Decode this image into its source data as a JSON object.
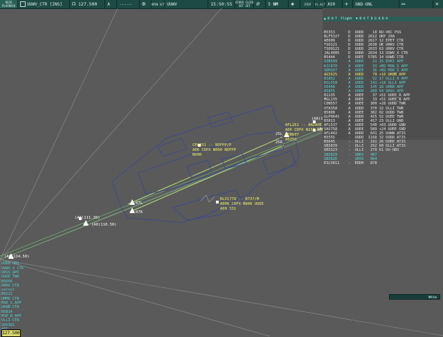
{
  "topbar": {
    "app_label_1": "RECD",
    "app_label_2": "PLAYBACK",
    "sector": "UUWV_CTR [INS]",
    "frequency": "127.500",
    "frequency_sub": "A",
    "blank_field": "-----",
    "open_sct_label": "OPEN SCT",
    "open_sct_value": "UUWV",
    "time": "15:50:55",
    "other_clock_label": "OTHER CLOCK",
    "set_1": "SET",
    "set_2": "SET",
    "range_value": "5",
    "range_unit": "NM",
    "step_label": "STEP",
    "fl_label": "FL ALT",
    "fl_value": "A50",
    "filter_value": "GND-UNL",
    "icons": [
      "headset-icon",
      "settings-icon",
      "cursor-icon",
      "satellite-icon",
      "nav-icon",
      "window-icon",
      "layout-icon",
      "close-icon"
    ]
  },
  "flight_list": {
    "header": "▲ D O T  Flight  ▼ D A T D G O D O",
    "rows": [
      {
        "text": "B5353      D  UUDD    18 RU-VKC PSS",
        "color": "white"
      },
      {
        "text": "BLF5327    D  UUDD  2612 UKP 20A",
        "color": "white"
      },
      {
        "text": "AE609      D  UUDD  2617 12 EPET CTR",
        "color": "white"
      },
      {
        "text": "TSO121     D  UUDD  2630 UK URRV CTR",
        "color": "white"
      },
      {
        "text": "TSO9121    D  UUDD  2633 63 URRV CTR",
        "color": "white"
      },
      {
        "text": "JAL4005    D  UUDD  2634 13 UUWV_X CTR",
        "color": "white"
      },
      {
        "text": "B5444      D  UUEE  5785 14 UUWD CTR",
        "color": "white"
      },
      {
        "text": "UZB509     A  UUDD    21 15 EVKI APP",
        "color": "blue"
      },
      {
        "text": "KJC870     A  UUEE    33 +M2 MSK_S APP",
        "color": "blue"
      },
      {
        "text": "SDM107     A  UUEE    36 +M2 MSK_S APP",
        "color": "blue"
      },
      {
        "text": "AUI625     A  UUDD    79 +16 UKBB APP",
        "color": "yellow"
      },
      {
        "text": "B5852      A  UUDD    92 17 ULLI R APP",
        "color": "blue"
      },
      {
        "text": "KGL558     A  UUDD   141 +18 ULLI APP",
        "color": "blue"
      },
      {
        "text": "I6408      A  UUDD   145 18 URRR APP",
        "color": "blue"
      },
      {
        "text": "B5855      A  UUDD   200 54 URSS APP",
        "color": "blue"
      },
      {
        "text": "B1135      A  UUEE    37 +51 UUEE_R APP",
        "color": "white"
      },
      {
        "text": "MGL135     A  UUEE    33 +51 UUEE_B APP",
        "color": "white"
      },
      {
        "text": "CON557     A  UUEE   300 +28 UUDD TWR",
        "color": "white"
      },
      {
        "text": "UTA358     A  UUDD   370 22 ULLI TWR",
        "color": "white"
      },
      {
        "text": "B5808      A  UUEE   382 02 UUDD TWR",
        "color": "white"
      },
      {
        "text": "GLP9641    A  UUDD   415 52 UUEE TWR",
        "color": "white"
      },
      {
        "text": "B5813      A  UUEE   417 23 ULLI GND",
        "color": "white"
      },
      {
        "text": "AFL537     A  UUEE   540 +03 UUDD GND",
        "color": "white"
      },
      {
        "text": "SAS758     A  UUEE   589 +24 UUEE GND",
        "color": "white"
      },
      {
        "text": "AFL442     A  UUDD   641 25 UUWW ATIS",
        "color": "white"
      },
      {
        "text": "B5555      -  UUDD  1168 32 UUDD ATIS",
        "color": "white"
      },
      {
        "text": "B5645      -  ULLI   191 26 UUEE ATIS",
        "color": "white"
      },
      {
        "text": "SBI839     -  ULLI   252 60 ULLI ATIS",
        "color": "white"
      },
      {
        "text": "URSS23     -  ULLI   279 61 UU-OBS",
        "color": "white"
      },
      {
        "text": "SBI829     -  URRV   487",
        "color": "blue"
      },
      {
        "text": "SBI82D     -  URSS   964",
        "color": "blue"
      },
      {
        "text": "ESL5811    -  EDDH   878",
        "color": "white"
      }
    ]
  },
  "left_list": {
    "items": [
      "UUDD OBS",
      "UUWV_X CTR",
      "URSS_APP",
      "UUDD TWR",
      "B5656",
      "URRV CTR",
      "server",
      "B9222",
      "UMMV CTR",
      "MSK_S APP",
      "UKBB CTR",
      "B5814",
      "MSK_B APP",
      "ULLI CTR",
      "SDV381",
      "ATC"
    ],
    "active_frequency": "127.500"
  },
  "scale_bar": {
    "label": "NM/km"
  },
  "radar": {
    "labels": [
      {
        "text": "AFL261 -- AN2AHE",
        "color": "yellow"
      },
      {
        "text": "A06 CDPX N236 NOFPP",
        "color": "yellow"
      },
      {
        "text": "WZB607",
        "color": "yellow"
      },
      {
        "text": "A0250",
        "color": "yellow"
      },
      {
        "text": "CPA251 -- NOFPP/P",
        "color": "yellow"
      },
      {
        "text": "A06 CDPX N000 NOFPP",
        "color": "yellow"
      },
      {
        "text": "N000",
        "color": "yellow"
      },
      {
        "text": "RLV1778 -- B737/M",
        "color": "yellow"
      },
      {
        "text": "A006 CDPX N000 UUEE",
        "color": "yellow"
      },
      {
        "text": "A09 331",
        "color": "yellow"
      },
      {
        "text": "(A0)100.90)",
        "color": "white"
      },
      {
        "text": "(A0)108.90)",
        "color": "white"
      },
      {
        "text": "(A0)111.30)",
        "color": "white"
      },
      {
        "text": "(A0)110.50)",
        "color": "white"
      },
      {
        "text": "(A0)114.50)",
        "color": "white"
      },
      {
        "text": "07L",
        "color": "white"
      },
      {
        "text": "07R",
        "color": "white"
      },
      {
        "text": "25L",
        "color": "white"
      },
      {
        "text": "25R",
        "color": "white"
      }
    ]
  }
}
